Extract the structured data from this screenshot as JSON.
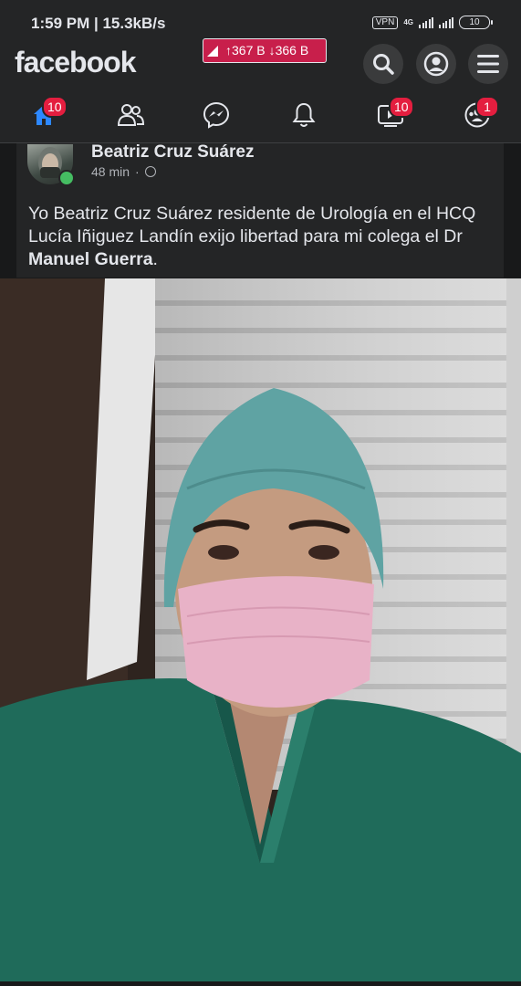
{
  "status_bar": {
    "time_speed": "1:59 PM | 15.3kB/s",
    "vpn": "VPN",
    "network": "4G",
    "battery": "10"
  },
  "header": {
    "logo": "facebook",
    "speed_up": "↑367 B",
    "speed_down": "↓366 B"
  },
  "nav": {
    "home_badge": "10",
    "watch_badge": "10",
    "groups_badge": "1"
  },
  "post": {
    "author": "Beatriz Cruz Suárez",
    "time": "48 min",
    "separator": "·",
    "text_main": "Yo Beatriz Cruz Suárez residente de Urología en el HCQ Lucía Iñiguez Landín exijo libertad para mi colega el Dr ",
    "text_bold": "Manuel Guerra",
    "text_end": "."
  },
  "colors": {
    "background": "#18191a",
    "surface": "#242526",
    "text": "#e4e6eb",
    "secondary_text": "#b0b3b8",
    "badge": "#e41e3f",
    "brand_blue": "#2d88ff",
    "online": "#45bd62"
  },
  "icons": {
    "home": "home-icon",
    "friends": "friends-icon",
    "messenger": "messenger-icon",
    "notifications": "bell-icon",
    "watch": "watch-icon",
    "groups": "groups-icon",
    "search": "search-icon",
    "profile": "profile-icon",
    "menu": "menu-icon",
    "privacy": "globe-icon"
  }
}
